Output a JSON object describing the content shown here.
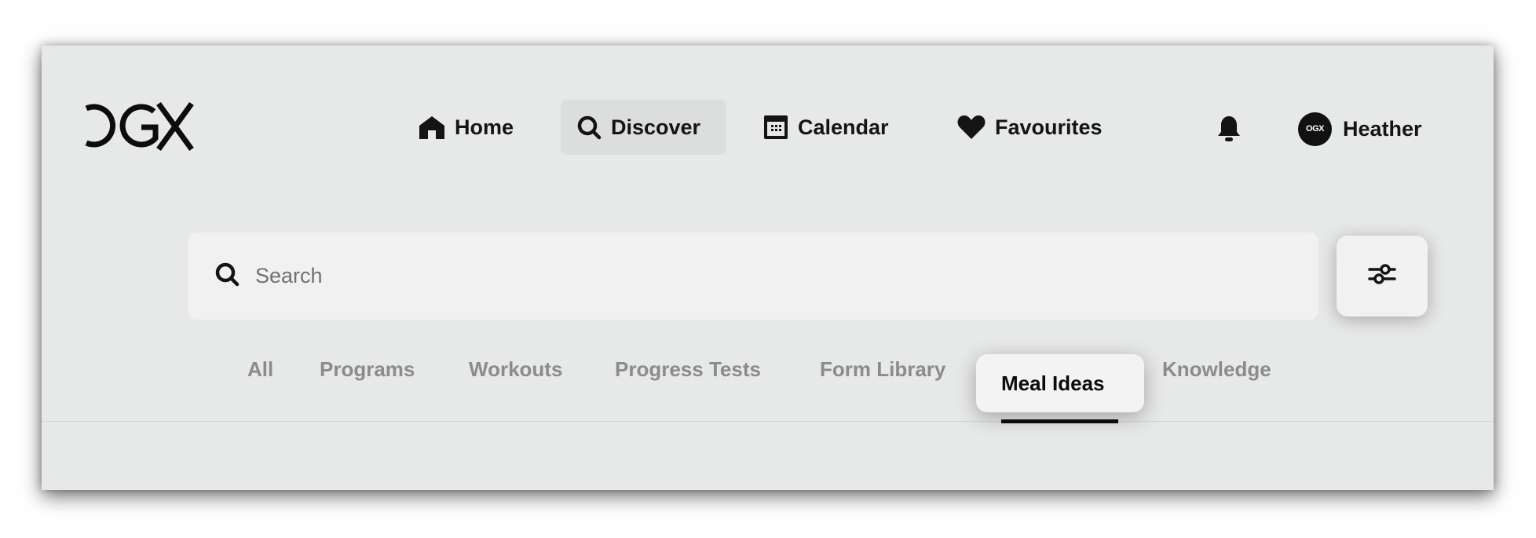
{
  "app": {
    "logo_text": "OGX"
  },
  "nav": {
    "items": [
      {
        "label": "Home",
        "icon": "home-icon",
        "active": false
      },
      {
        "label": "Discover",
        "icon": "search-icon",
        "active": true
      },
      {
        "label": "Calendar",
        "icon": "calendar-icon",
        "active": false
      },
      {
        "label": "Favourites",
        "icon": "heart-icon",
        "active": false
      }
    ]
  },
  "header": {
    "notifications_icon": "bell-icon",
    "user": {
      "name": "Heather",
      "avatar_text": "OGX"
    }
  },
  "search": {
    "placeholder": "Search",
    "value": ""
  },
  "filters": {
    "icon": "sliders-icon"
  },
  "tabs": {
    "items": [
      {
        "label": "All",
        "active": false
      },
      {
        "label": "Programs",
        "active": false
      },
      {
        "label": "Workouts",
        "active": false
      },
      {
        "label": "Progress Tests",
        "active": false
      },
      {
        "label": "Form Library",
        "active": false
      },
      {
        "label": "Meal Ideas",
        "active": true
      },
      {
        "label": "Knowledge",
        "active": false
      }
    ]
  },
  "colors": {
    "background": "#e7e8e8",
    "active_nav_bg": "#dcdddd",
    "text_primary": "#141414",
    "tab_inactive": "#8b8b8b"
  }
}
